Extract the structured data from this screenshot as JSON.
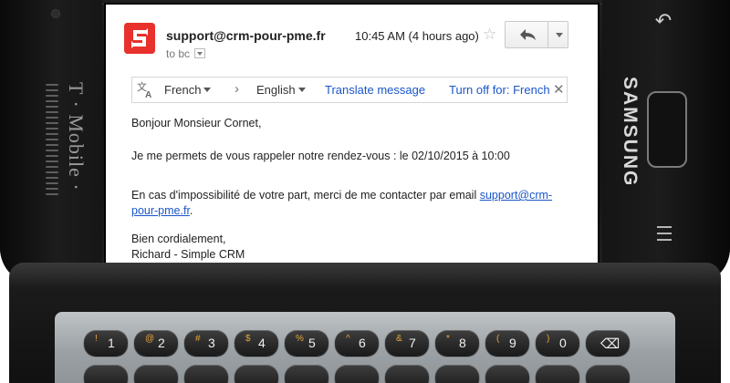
{
  "device": {
    "carrier_brand": "T · Mobile ·",
    "maker_brand": "SAMSUNG"
  },
  "email": {
    "sender": "support@crm-pour-pme.fr",
    "to_line": "to bc",
    "timestamp": "10:45 AM (4 hours ago)",
    "avatar_icon": "app-logo-icon",
    "actions": {
      "reply_icon": "reply-icon",
      "more_icon": "chevron-down-icon",
      "star_icon": "star-icon"
    }
  },
  "translate_bar": {
    "source_language": "French",
    "target_language": "English",
    "translate_link": "Translate message",
    "turn_off_link": "Turn off for: French",
    "close_icon": "close-icon"
  },
  "body": {
    "greeting": "Bonjour Monsieur Cornet,",
    "line1": "Je me permets de vous rappeler notre rendez-vous : le 02/10/2015 à 10:00",
    "line2_prefix": "En cas d'impossibilité de votre part, merci de me contacter par email ",
    "line2_link": "support@crm-pour-pme.fr",
    "line2_suffix": ".",
    "closing": "Bien cordialement,",
    "signature": "Richard - Simple CRM"
  },
  "keyboard": {
    "row1": [
      {
        "sym": "!",
        "main": "1"
      },
      {
        "sym": "@",
        "main": "2"
      },
      {
        "sym": "#",
        "main": "3"
      },
      {
        "sym": "$",
        "main": "4"
      },
      {
        "sym": "%",
        "main": "5"
      },
      {
        "sym": "^",
        "main": "6"
      },
      {
        "sym": "&",
        "main": "7"
      },
      {
        "sym": "*",
        "main": "8"
      },
      {
        "sym": "(",
        "main": "9"
      },
      {
        "sym": ")",
        "main": "0"
      },
      {
        "sym": "",
        "main": "⌫"
      }
    ],
    "row2": [
      {
        "sym": "",
        "main": ""
      },
      {
        "sym": "",
        "main": ""
      },
      {
        "sym": "",
        "main": ""
      },
      {
        "sym": "",
        "main": ""
      },
      {
        "sym": "",
        "main": ""
      },
      {
        "sym": "",
        "main": ""
      },
      {
        "sym": "",
        "main": ""
      },
      {
        "sym": "",
        "main": ""
      },
      {
        "sym": "",
        "main": ""
      },
      {
        "sym": "",
        "main": ""
      },
      {
        "sym": "",
        "main": ""
      }
    ]
  },
  "colors": {
    "link": "#1a56c9",
    "avatar": "#e8312c",
    "key_symbol": "#e8a43a"
  }
}
